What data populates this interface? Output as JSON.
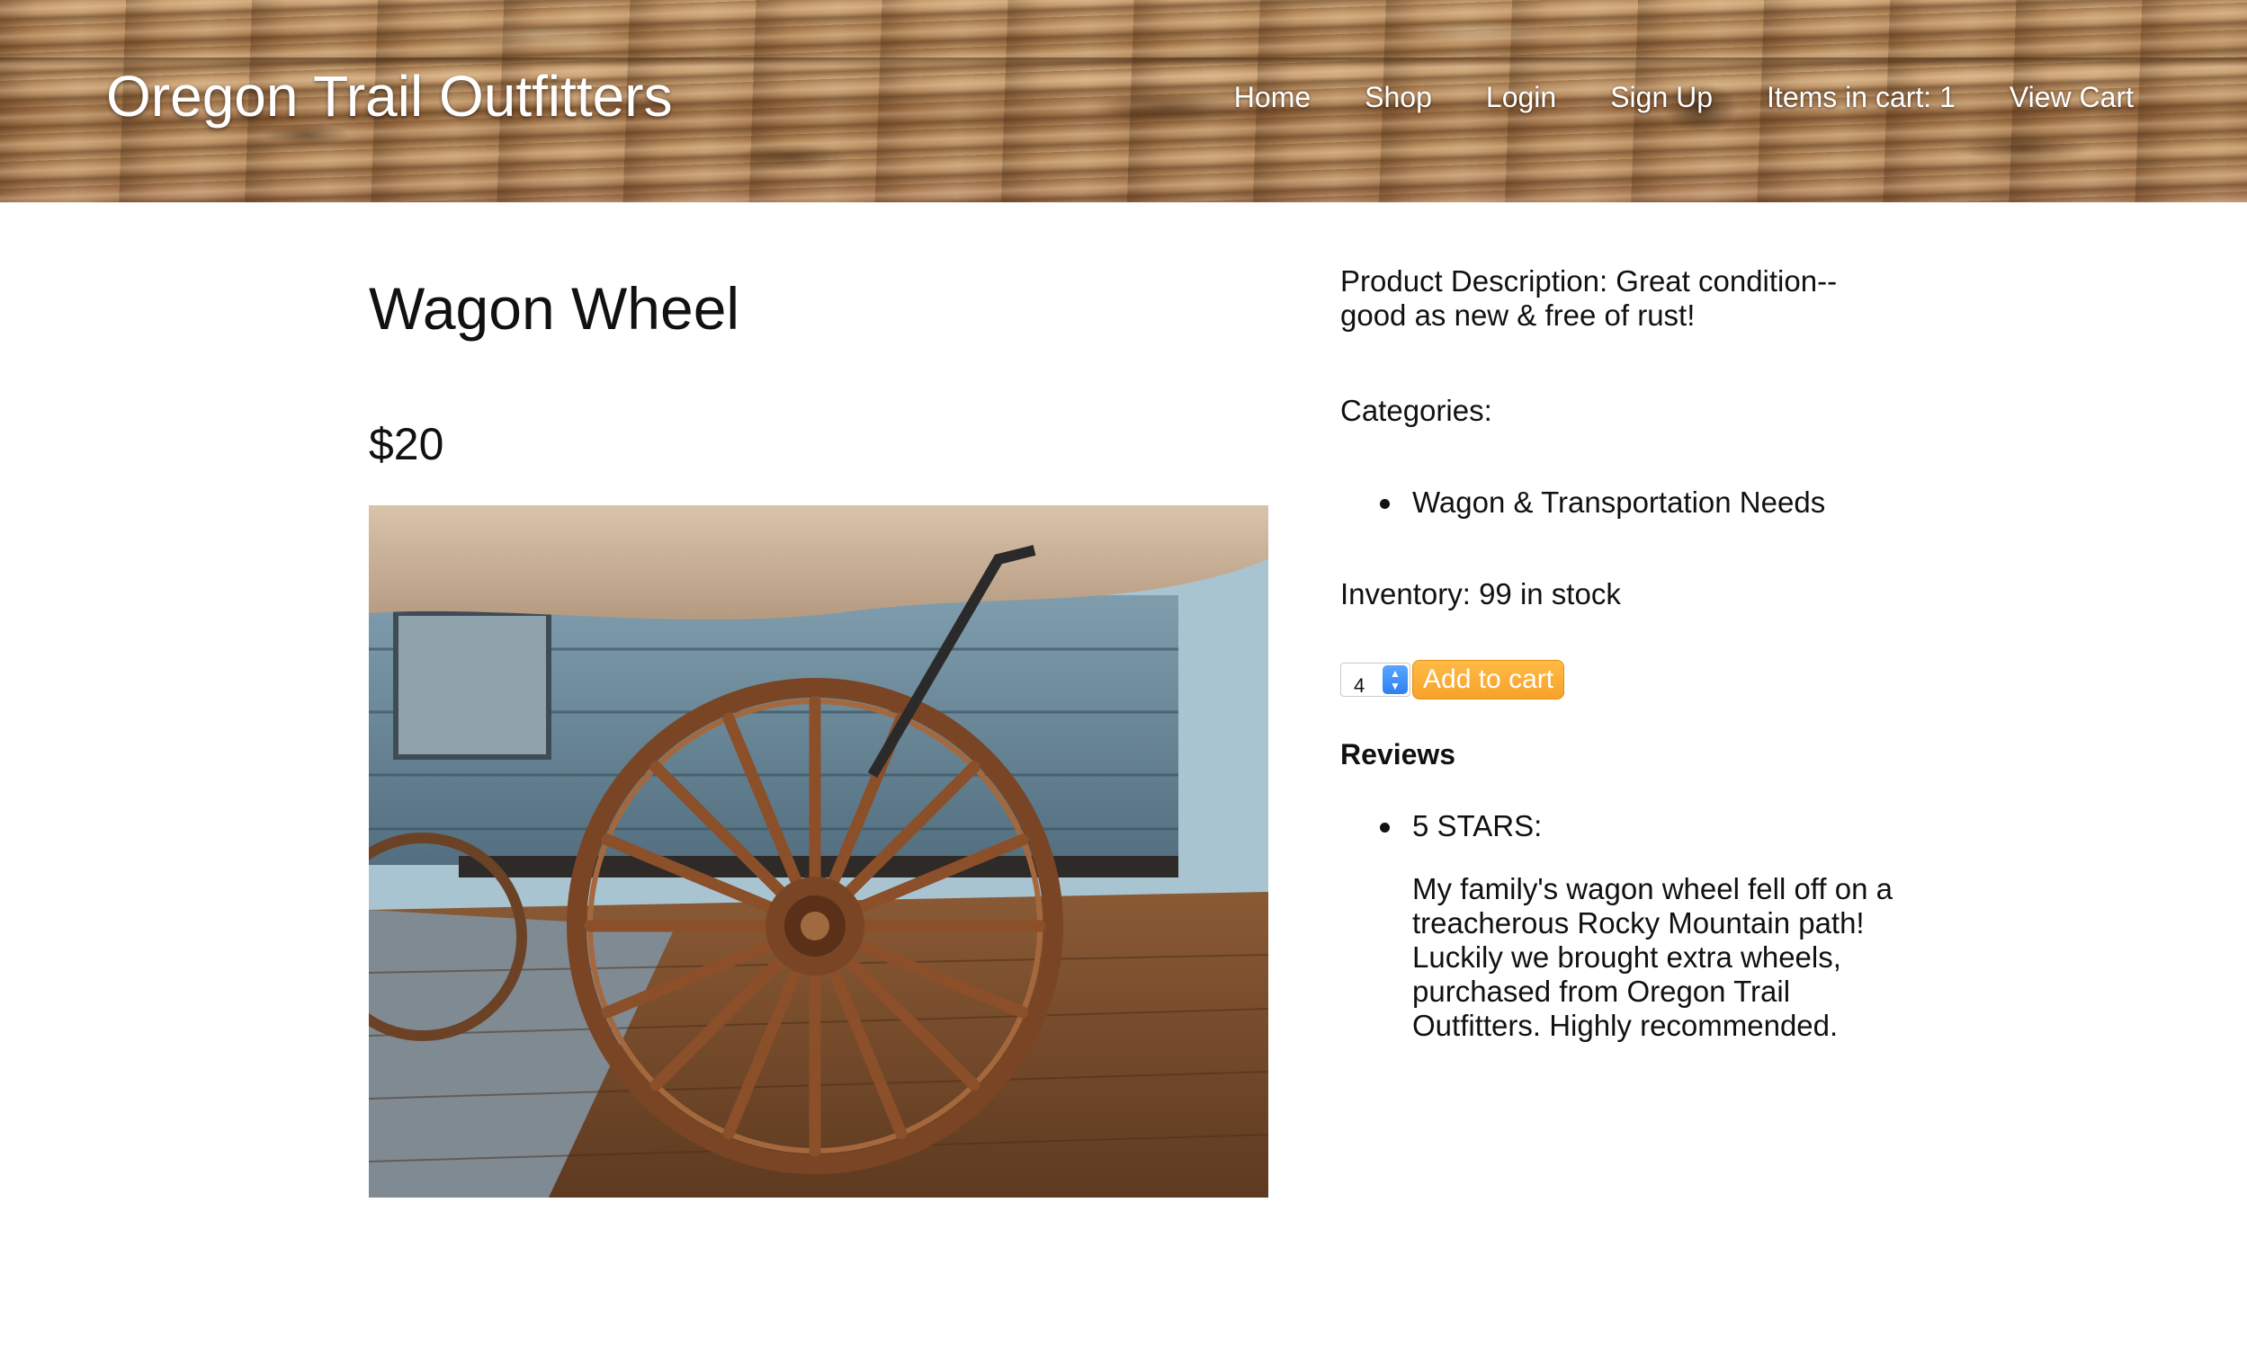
{
  "header": {
    "brand": "Oregon Trail Outfitters",
    "nav": [
      "Home",
      "Shop",
      "Login",
      "Sign Up",
      "Items in cart: 1",
      "View Cart"
    ]
  },
  "product": {
    "title": "Wagon Wheel",
    "price": "$20",
    "description": "Product Description: Great condition--good as new & free of rust!",
    "categories_label": "Categories:",
    "categories": [
      "Wagon & Transportation Needs"
    ],
    "inventory": "Inventory: 99 in stock"
  },
  "cart": {
    "quantity": "4",
    "add_label": "Add to cart"
  },
  "reviews": {
    "label": "Reviews",
    "items": [
      {
        "rating": "5 STARS:",
        "text": "My family's wagon wheel fell off on a treacherous Rocky Mountain path! Luckily we brought extra wheels, purchased from Oregon Trail Outfitters. Highly recommended."
      }
    ]
  },
  "colors": {
    "button": "#f7a22a",
    "stepper": "#2f7ff2"
  }
}
